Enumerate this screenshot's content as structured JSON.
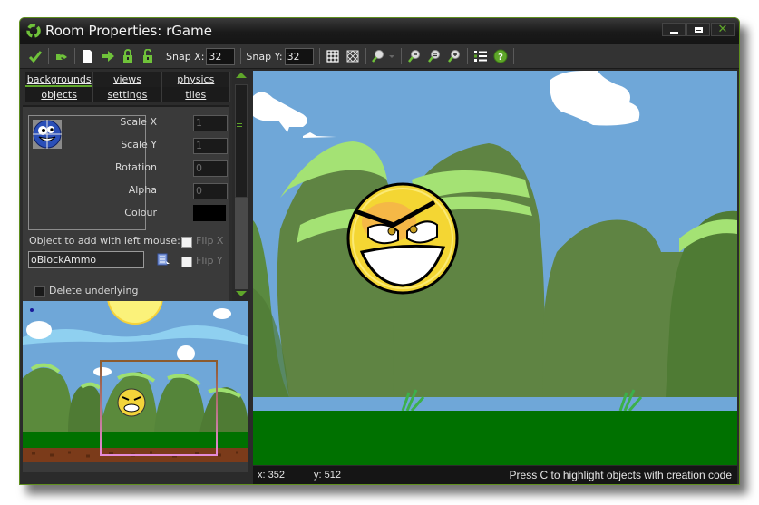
{
  "window": {
    "title": "Room Properties: rGame",
    "accent_color": "#5fa62a",
    "controls": [
      "minimize",
      "maximize",
      "close"
    ]
  },
  "toolbar": {
    "buttons": [
      {
        "name": "ok",
        "icon": "checkmark-icon"
      },
      {
        "name": "undo",
        "icon": "undo-icon"
      },
      {
        "name": "clear",
        "icon": "new-document-icon"
      },
      {
        "name": "shift",
        "icon": "arrow-right-icon"
      },
      {
        "name": "lock",
        "icon": "lock-icon"
      },
      {
        "name": "unlock",
        "icon": "unlock-icon"
      }
    ],
    "snap_x_label": "Snap X:",
    "snap_x_value": "32",
    "snap_y_label": "Snap Y:",
    "snap_y_value": "32",
    "grid_toggle_icon": "grid-icon",
    "isometric_toggle_icon": "iso-grid-icon",
    "zoom_dropdown_icon": "magnifier-dropdown-icon",
    "zoom_buttons": [
      "zoom-out-icon",
      "zoom-reset-icon",
      "zoom-in-icon"
    ],
    "list_icon": "list-icon",
    "help_icon": "help-icon"
  },
  "tabs": {
    "row1": [
      "backgrounds",
      "views",
      "physics"
    ],
    "row2": [
      "objects",
      "settings",
      "tiles"
    ],
    "active": "backgrounds"
  },
  "objects_panel": {
    "scale_x_label": "Scale X",
    "scale_x_value": "1",
    "scale_y_label": "Scale Y",
    "scale_y_value": "1",
    "rotation_label": "Rotation",
    "rotation_value": "0",
    "alpha_label": "Alpha",
    "alpha_value": "0",
    "colour_label": "Colour",
    "colour_value": "#000000",
    "object_label": "Object to add with left mouse:",
    "object_value": "oBlockAmmo",
    "flip_x_label": "Flip X",
    "flip_x_checked": false,
    "flip_y_label": "Flip Y",
    "flip_y_checked": false,
    "delete_underlying_label": "Delete underlying",
    "delete_underlying_checked": false
  },
  "status": {
    "x": "x: 352",
    "y": "y: 512",
    "hint": "Press C to highlight objects with creation code"
  }
}
